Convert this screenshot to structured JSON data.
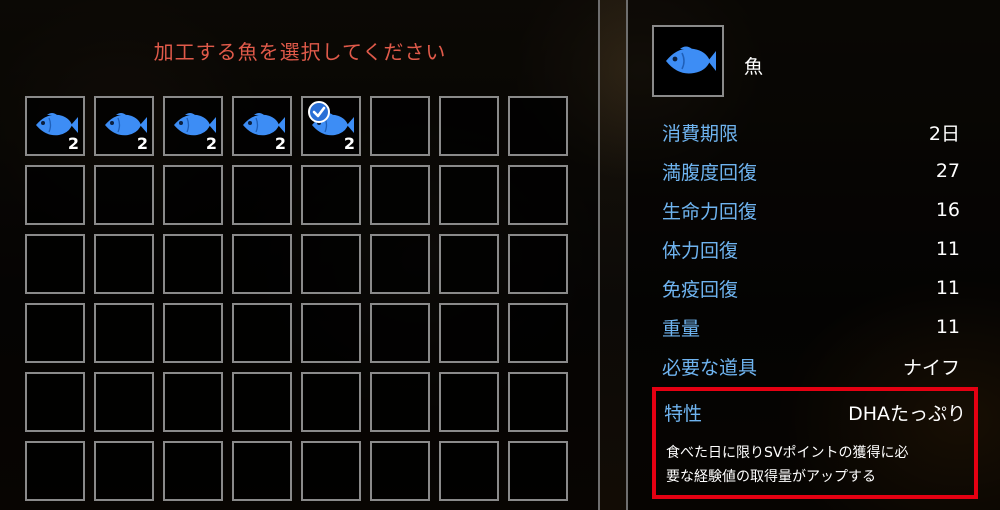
{
  "inventory": {
    "title": "加工する魚を選択してください",
    "items": [
      {
        "icon": "fish-icon",
        "qty": "2",
        "selected": false
      },
      {
        "icon": "fish-icon",
        "qty": "2",
        "selected": false
      },
      {
        "icon": "fish-icon",
        "qty": "2",
        "selected": false
      },
      {
        "icon": "fish-icon",
        "qty": "2",
        "selected": false
      },
      {
        "icon": "fish-icon",
        "qty": "2",
        "selected": true
      }
    ],
    "columns": 8,
    "rows": 6
  },
  "detail": {
    "icon": "fish-icon",
    "name": "魚",
    "stats": [
      {
        "label": "消費期限",
        "value": "2日"
      },
      {
        "label": "満腹度回復",
        "value": "27"
      },
      {
        "label": "生命力回復",
        "value": "16"
      },
      {
        "label": "体力回復",
        "value": "11"
      },
      {
        "label": "免疫回復",
        "value": "11"
      },
      {
        "label": "重量",
        "value": "11"
      },
      {
        "label": "必要な道具",
        "value": "ナイフ"
      }
    ],
    "trait": {
      "label": "特性",
      "value": "DHAたっぷり",
      "description_line1": "食べた日に限りSVポイントの獲得に必",
      "description_line2": "要な経験値の取得量がアップする"
    }
  },
  "colors": {
    "title": "#e05a4a",
    "label": "#6fb4f0",
    "fish": "#3d8df5",
    "highlight_border": "#e50012"
  }
}
